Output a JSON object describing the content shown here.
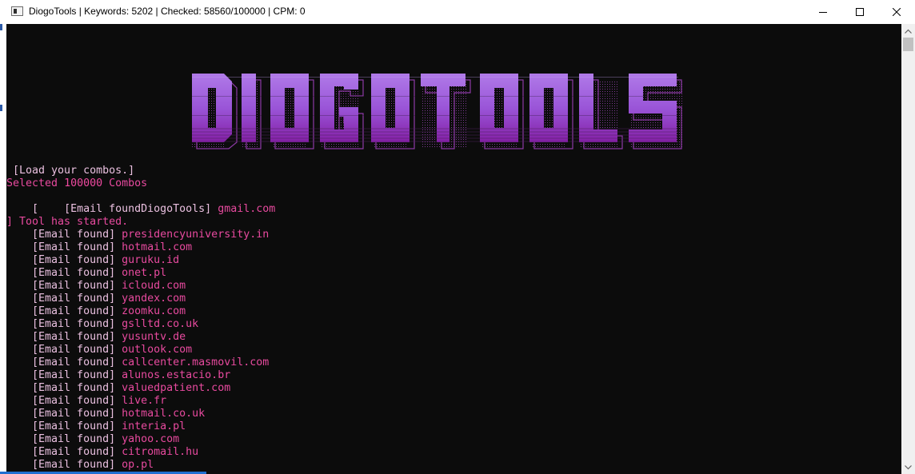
{
  "window": {
    "title": "DiogoTools | Keywords: 5202 | Checked: 58560/100000 | CPM: 0",
    "minimize_icon": "minimize-icon",
    "maximize_icon": "maximize-icon",
    "close_icon": "close-icon"
  },
  "banner": {
    "text": "DIOGOTOOLS",
    "colors": {
      "top": "#a66ee0",
      "bottom": "#8c1fa8",
      "shadow": "#6d3a8c"
    }
  },
  "console": {
    "load_prompt": " [Load your combos.]",
    "selected_prefix": "Selected ",
    "selected_count": "100000",
    "selected_suffix": " Combos",
    "glitch_line_bracket": "    [    ",
    "glitch_line_text": "[Email foundDiogoTools] ",
    "glitch_line_domain": "gmail.com",
    "started_line": "] Tool has started.",
    "found_label": "    [Email found] ",
    "found_domains": [
      "presidencyuniversity.in",
      "hotmail.com",
      "guruku.id",
      "onet.pl",
      "icloud.com",
      "yandex.com",
      "zoomku.com",
      "gslltd.co.uk",
      "yusuntv.de",
      "outlook.com",
      "callcenter.masmovil.com",
      "alunos.estacio.br",
      "valuedpatient.com",
      "live.fr",
      "hotmail.co.uk",
      "interia.pl",
      "yahoo.com",
      "citromail.hu",
      "op.pl"
    ]
  },
  "colors": {
    "console_bg": "#0c0c0c",
    "pink": "#e84a9f",
    "pale_pink": "#eac0e0"
  }
}
